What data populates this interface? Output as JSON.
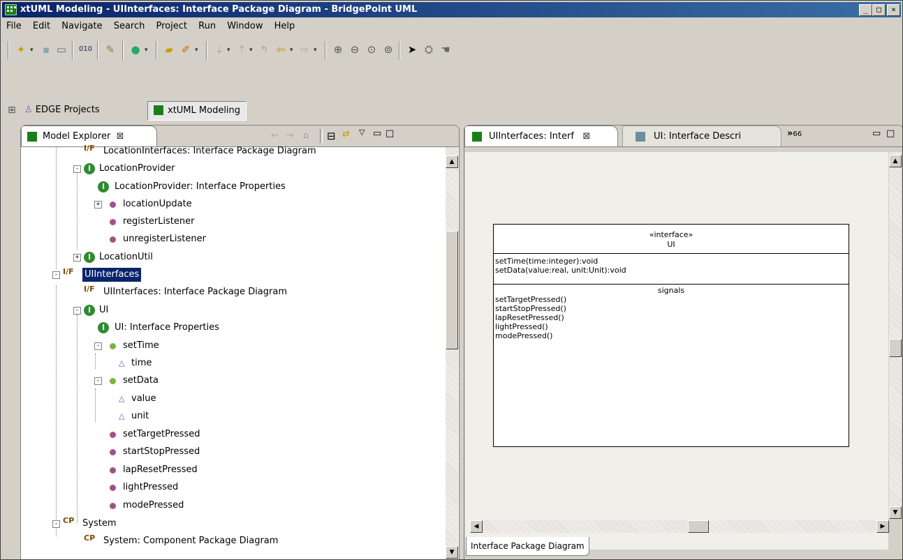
{
  "window": {
    "title": "xtUML Modeling - UIInterfaces: Interface Package Diagram - BridgePoint UML",
    "controls": {
      "minimize": "_",
      "maximize": "□",
      "close": "×"
    }
  },
  "menu": [
    "File",
    "Edit",
    "Navigate",
    "Search",
    "Project",
    "Run",
    "Window",
    "Help"
  ],
  "perspectives": [
    {
      "label": "EDGE Projects",
      "icon": "user-icon"
    },
    {
      "label": "xtUML Modeling",
      "icon": "xtuml-icon",
      "active": true
    }
  ],
  "model_explorer": {
    "tab_label": "Model Explorer",
    "tree": [
      {
        "label": "LocationInterfaces: Interface Package Diagram",
        "icon": "pkg"
      },
      {
        "label": "LocationProvider",
        "icon": "interface",
        "expander": "-"
      },
      {
        "label": "LocationProvider: Interface Properties",
        "icon": "interface"
      },
      {
        "label": "locationUpdate",
        "icon": "signal",
        "expander": "+"
      },
      {
        "label": "registerListener",
        "icon": "signal"
      },
      {
        "label": "unregisterListener",
        "icon": "signal"
      },
      {
        "label": "LocationUtil",
        "icon": "interface",
        "expander": "+"
      },
      {
        "label": "UIInterfaces",
        "icon": "pkg",
        "expander": "-",
        "selected": true
      },
      {
        "label": "UIInterfaces: Interface Package Diagram",
        "icon": "pkg"
      },
      {
        "label": "UI",
        "icon": "interface",
        "expander": "-"
      },
      {
        "label": "UI: Interface Properties",
        "icon": "interface"
      },
      {
        "label": "setTime",
        "icon": "operation",
        "expander": "-"
      },
      {
        "label": "time",
        "icon": "param"
      },
      {
        "label": "setData",
        "icon": "operation",
        "expander": "-"
      },
      {
        "label": "value",
        "icon": "param"
      },
      {
        "label": "unit",
        "icon": "param"
      },
      {
        "label": "setTargetPressed",
        "icon": "signal"
      },
      {
        "label": "startStopPressed",
        "icon": "signal"
      },
      {
        "label": "lapResetPressed",
        "icon": "signal"
      },
      {
        "label": "lightPressed",
        "icon": "signal"
      },
      {
        "label": "modePressed",
        "icon": "signal"
      },
      {
        "label": "System",
        "icon": "cpkg",
        "expander": "-"
      },
      {
        "label": "System: Component Package Diagram",
        "icon": "cpkg"
      }
    ]
  },
  "editor": {
    "tabs": [
      {
        "label": "UIInterfaces: Interf",
        "active": true
      },
      {
        "label": "UI: Interface Descri",
        "active": false
      }
    ],
    "overflow_label": "»",
    "overflow_count": "66",
    "bottom_tab": "Interface Package Diagram",
    "uml": {
      "stereotype": "«interface»",
      "name": "UI",
      "operations": [
        "setTime(time:integer):void",
        "setData(value:real, unit:Unit):void"
      ],
      "signals_title": "signals",
      "signals": [
        "setTargetPressed()",
        "startStopPressed()",
        "lapResetPressed()",
        "lightPressed()",
        "modePressed()"
      ]
    }
  },
  "colors": {
    "selection": "#0a246a",
    "interface_icon": "#2e8b2e",
    "signal_icon": "#a0528a",
    "operation_icon": "#7cb342"
  }
}
